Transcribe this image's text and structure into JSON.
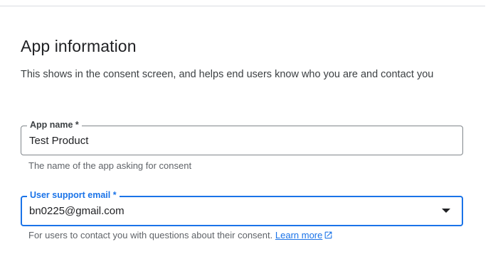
{
  "section": {
    "title": "App information",
    "description": "This shows in the consent screen, and helps end users know who you are and contact you"
  },
  "app_name": {
    "label": "App name *",
    "value": "Test Product",
    "hint": "The name of the app asking for consent"
  },
  "support_email": {
    "label": "User support email *",
    "value": "bn0225@gmail.com",
    "hint": "For users to contact you with questions about their consent.",
    "link_label": "Learn more",
    "link_icon": "open-in-new-icon"
  },
  "colors": {
    "accent": "#1a73e8",
    "border": "#80868b",
    "hint_text": "#5f6368"
  }
}
